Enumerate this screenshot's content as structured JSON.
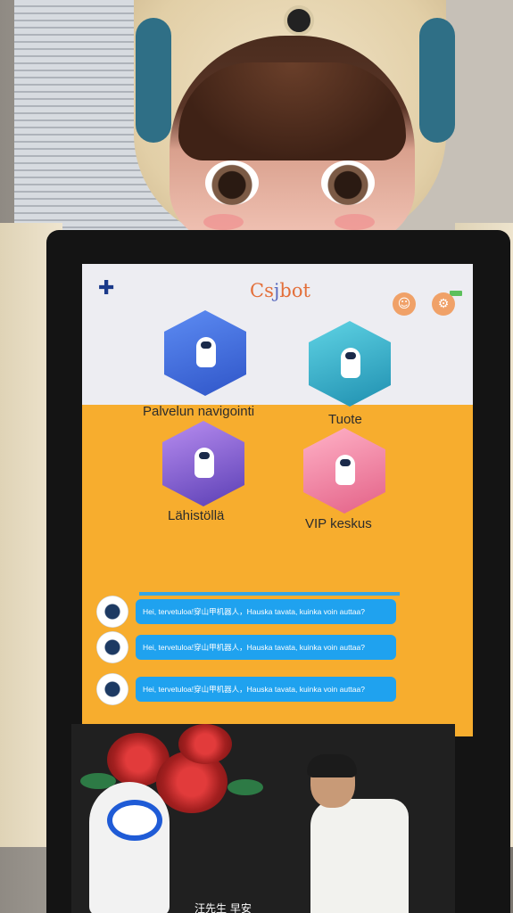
{
  "header": {
    "flag_icon": "finland-flag-icon",
    "logo_text_left": "Cs",
    "logo_text_accent": "j",
    "logo_text_right": "bot"
  },
  "menu": {
    "items": [
      {
        "label": "Palvelun navigointi",
        "icon": "navigation-robot-icon"
      },
      {
        "label": "Tuote",
        "icon": "product-robot-icon"
      },
      {
        "label": "Lähistöllä",
        "icon": "nearby-map-icon"
      },
      {
        "label": "VIP keskus",
        "icon": "vip-lounge-icon"
      }
    ]
  },
  "chat": {
    "messages": [
      {
        "text": "Hei, tervetuloa!穿山甲机器人，Hauska tavata, kuinka voin auttaa?"
      },
      {
        "text": "Hei, tervetuloa!穿山甲机器人，Hauska tavata, kuinka voin auttaa?"
      },
      {
        "text": "Hei, tervetuloa!穿山甲机器人，Hauska tavata, kuinka voin auttaa?"
      }
    ]
  },
  "video": {
    "subtitle": "汪先生 早安"
  },
  "colors": {
    "screen_top": "#ededf2",
    "screen_yellow": "#f7ad2e",
    "bubble_blue": "#1fa2ef",
    "logo_orange": "#e36f3a"
  }
}
